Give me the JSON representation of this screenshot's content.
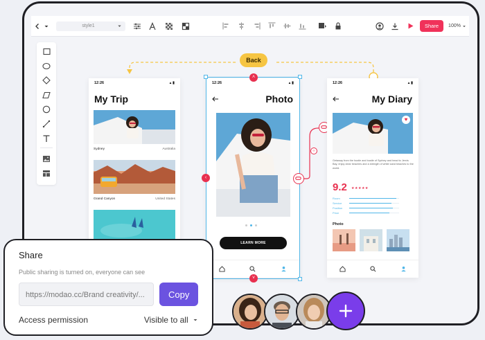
{
  "toolbar": {
    "style_value": "style1",
    "share_label": "Share",
    "zoom": "100%"
  },
  "flow": {
    "back_label": "Back"
  },
  "screens": {
    "trip": {
      "time": "12:26",
      "title": "My Trip",
      "cards": [
        {
          "left": "Sydney",
          "right": "Australia"
        },
        {
          "left": "Grand Canyon",
          "right": "United States"
        }
      ]
    },
    "photo": {
      "time": "12:26",
      "title": "Photo",
      "button": "LEARN MORE"
    },
    "diary": {
      "time": "12:26",
      "title": "My Diary",
      "description": "Getaway from the hustle and bustle of Sydney and head to Jervis Bay, enjoy clear beaches and a strength of white sand beaches to the world.",
      "rating": "9.2",
      "stars": "★★★★★",
      "metrics": [
        {
          "label": "Room",
          "value": 0.95
        },
        {
          "label": "Service",
          "value": 0.85
        },
        {
          "label": "Position",
          "value": 0.88
        },
        {
          "label": "Price",
          "value": 0.8
        }
      ],
      "photo_label": "Photo"
    }
  },
  "share_panel": {
    "title": "Share",
    "subtitle": "Public sharing is turned on, everyone can see",
    "url": "https://modao.cc/Brand creativity/...",
    "copy_label": "Copy",
    "permission_label": "Access permission",
    "permission_value": "Visible to all"
  },
  "colors": {
    "accent": "#f0325a",
    "primary": "#6b53e0",
    "selection": "#4fb6e8",
    "back_tag": "#f6c543",
    "add": "#7a3dea"
  }
}
